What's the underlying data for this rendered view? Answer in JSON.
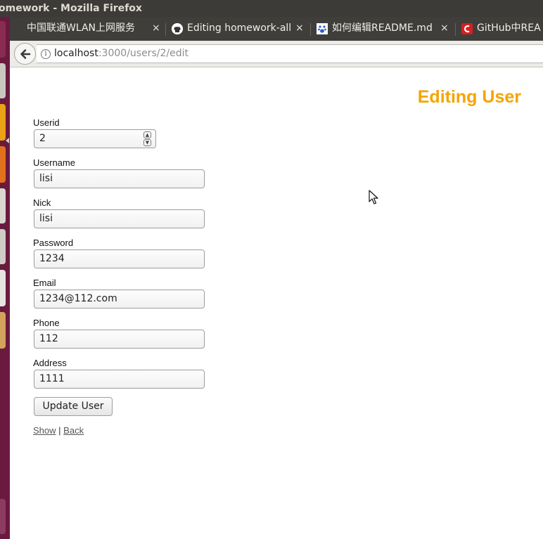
{
  "window": {
    "title": "omework - Mozilla Firefox"
  },
  "tabs": [
    {
      "label": "中国联通WLAN上网服务",
      "icon": "none",
      "close": "×"
    },
    {
      "label": "Editing homework-all",
      "icon": "github-icon",
      "close": "×"
    },
    {
      "label": "如何编辑README.md",
      "icon": "baidu-paw-icon",
      "close": "×"
    },
    {
      "label": "GitHub中REA",
      "icon": "csdn-icon",
      "close": ""
    }
  ],
  "navbar": {
    "url_host": "localhost",
    "url_rest": ":3000/users/2/edit",
    "info_glyph": "i"
  },
  "page": {
    "heading": "Editing User",
    "fields": [
      {
        "label": "Userid",
        "value": "2",
        "type": "number"
      },
      {
        "label": "Username",
        "value": "lisi",
        "type": "text"
      },
      {
        "label": "Nick",
        "value": "lisi",
        "type": "text"
      },
      {
        "label": "Password",
        "value": "1234",
        "type": "text"
      },
      {
        "label": "Email",
        "value": "1234@112.com",
        "type": "text"
      },
      {
        "label": "Phone",
        "value": "112",
        "type": "text"
      },
      {
        "label": "Address",
        "value": "1111",
        "type": "text"
      }
    ],
    "submit_label": "Update User",
    "links": {
      "show": "Show",
      "separator": "|",
      "back": "Back"
    }
  },
  "colors": {
    "heading": "#f5a400",
    "launcher": "#6a1a3f",
    "titlebar": "#3c3b37",
    "tabstrip": "#3f3e3a"
  }
}
